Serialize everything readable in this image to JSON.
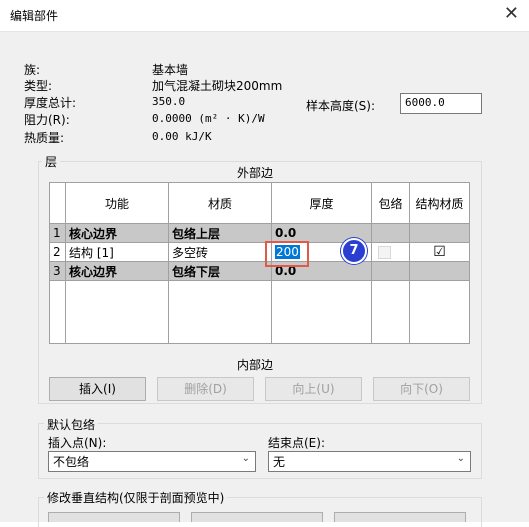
{
  "window": {
    "title": "编辑部件",
    "close_glyph": "✕"
  },
  "info": {
    "family_label": "族:",
    "family_value": "基本墙",
    "type_label": "类型:",
    "type_value": "加气混凝土砌块200mm",
    "thickness_label": "厚度总计:",
    "thickness_value": "350.0",
    "resistance_label": "阻力(R):",
    "resistance_value": "0.0000 (m² · K)/W",
    "thermal_label": "热质量:",
    "thermal_value": "0.00 kJ/K",
    "sample_height_label": "样本高度(S):",
    "sample_height_value": "6000.0"
  },
  "layers": {
    "group_label": "层",
    "exterior_label": "外部边",
    "interior_label": "内部边",
    "headers": [
      "功能",
      "材质",
      "厚度",
      "包络",
      "结构材质"
    ],
    "rows": [
      {
        "num": "1",
        "function": "核心边界",
        "material": "包络上层",
        "thickness": "0.0"
      },
      {
        "num": "2",
        "function": "结构 [1]",
        "material": "多空砖",
        "thickness": "200"
      },
      {
        "num": "3",
        "function": "核心边界",
        "material": "包络下层",
        "thickness": "0.0"
      }
    ],
    "structural_checked": "☑",
    "step_badge": "7"
  },
  "buttons": {
    "insert": "插入(I)",
    "delete": "删除(D)",
    "up": "向上(U)",
    "down": "向下(O)"
  },
  "wrap": {
    "group_label": "默认包络",
    "insert_point_label": "插入点(N):",
    "insert_point_value": "不包络",
    "end_point_label": "结束点(E):",
    "end_point_value": "无"
  },
  "modify": {
    "group_label": "修改垂直结构(仅限于剖面预览中)"
  }
}
